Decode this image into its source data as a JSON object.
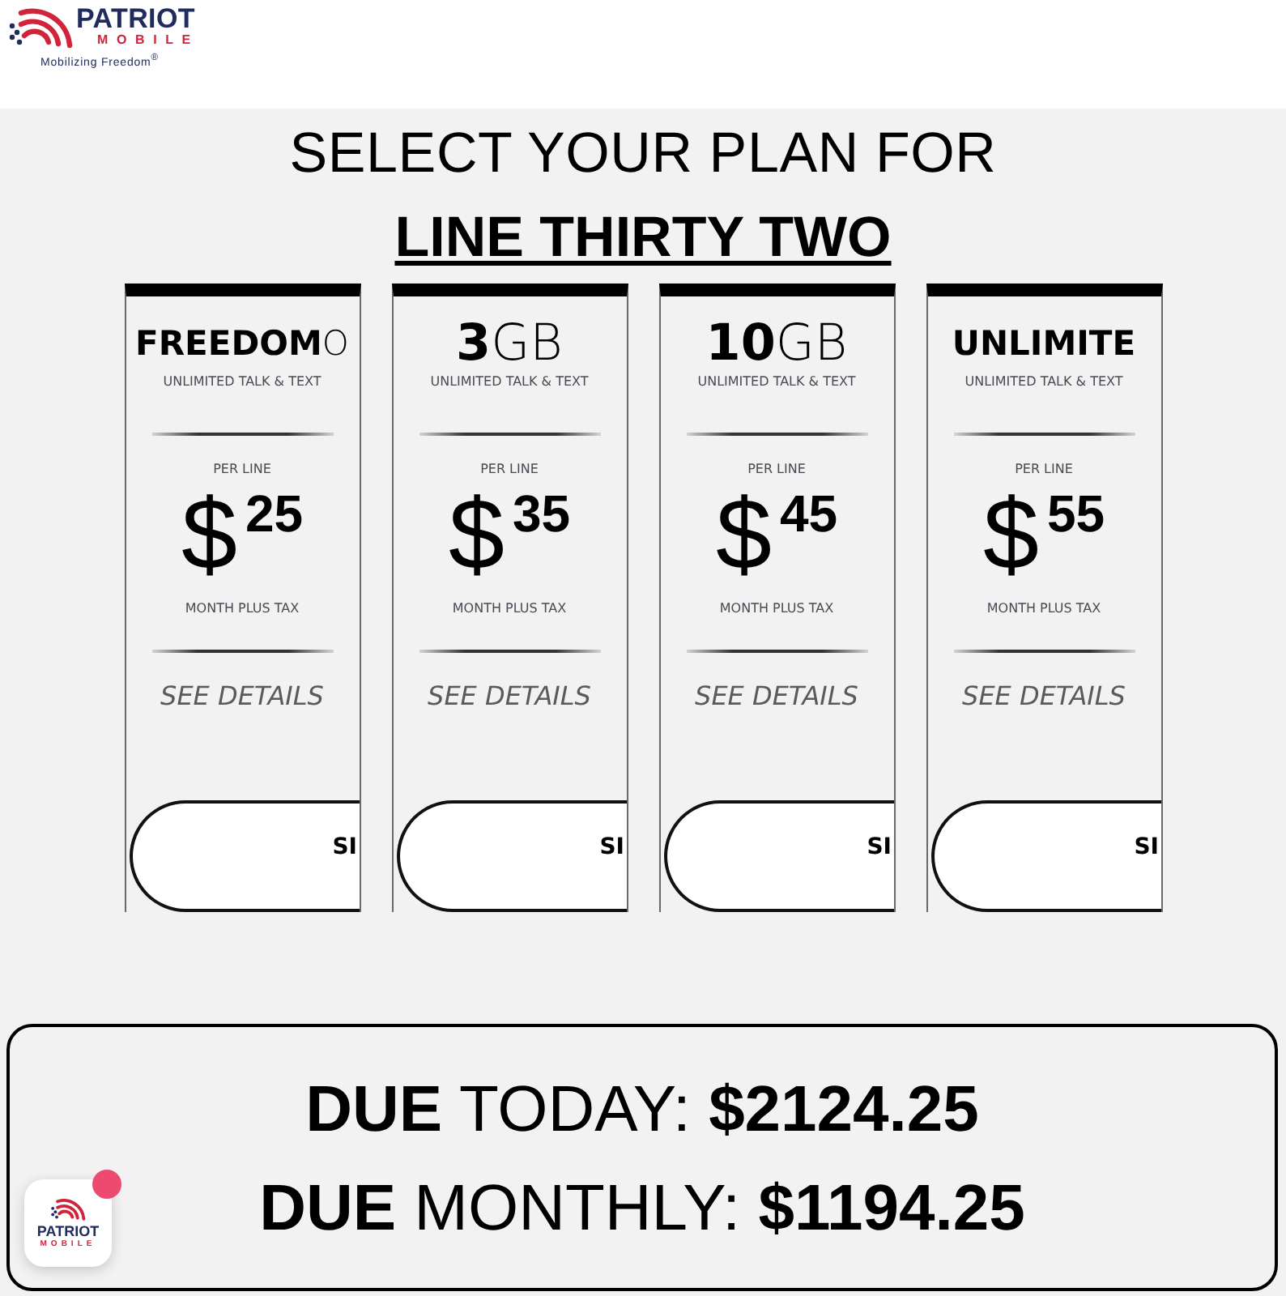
{
  "header": {
    "logo": {
      "name": "PATRIOT",
      "subname": "MOBILE",
      "tagline": "Mobilizing Freedom$^{®}$"
    }
  },
  "heading": {
    "title": "SELECT YOUR PLAN FOR",
    "subject": "LINE THIRTY TWO"
  },
  "plans": [
    {
      "title_bold": "FREEDOM",
      "title_light": "O",
      "subtitle": "UNLIMITED TALK & TEXT",
      "per": "PER LINE",
      "currency": "$",
      "price": "25",
      "period": "MONTH PLUS TAX",
      "details": "SEE DETAILS",
      "button": "SI"
    },
    {
      "title_bold": "3",
      "title_light": "GB",
      "subtitle": "UNLIMITED TALK & TEXT",
      "per": "PER LINE",
      "currency": "$",
      "price": "35",
      "period": "MONTH PLUS TAX",
      "details": "SEE DETAILS",
      "button": "SI"
    },
    {
      "title_bold": "10",
      "title_light": "GB",
      "subtitle": "UNLIMITED TALK & TEXT",
      "per": "PER LINE",
      "currency": "$",
      "price": "45",
      "period": "MONTH PLUS TAX",
      "details": "SEE DETAILS",
      "button": "SI"
    },
    {
      "title_bold": "UNLIMITE",
      "subtitle": "UNLIMITED TALK & TEXT",
      "per": "PER LINE",
      "currency": "$",
      "price": "55",
      "period": "MONTH PLUS TAX",
      "details": "SEE DETAILS",
      "button": "SI"
    }
  ],
  "totals": [
    "**DUE** TODAY: **$2124.25**",
    "**DUE** MONTHLY: **$1194.25**"
  ],
  "chat_widget": {
    "name": "PATRIOT",
    "subname": "MOBILE",
    "notification": true
  }
}
